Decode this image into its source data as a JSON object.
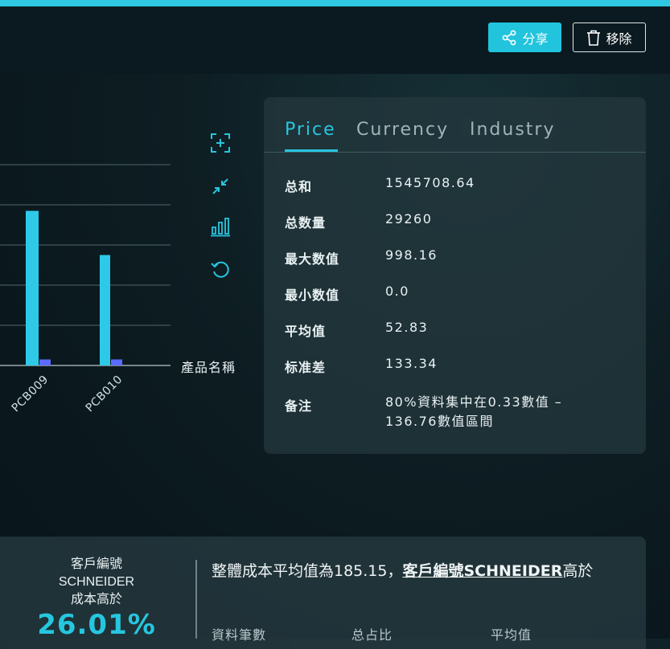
{
  "header": {
    "share_label": "分享",
    "remove_label": "移除",
    "share_icon": "share-icon",
    "remove_icon": "trash-icon"
  },
  "toolbar": {
    "icons": [
      "focus-plus-icon",
      "collapse-icon",
      "bar-chart-icon",
      "reset-icon"
    ]
  },
  "chart_data": {
    "type": "bar",
    "x_label": "產品名稱",
    "categories": [
      "PCB009",
      "PCB010"
    ],
    "series": [
      {
        "color": "#2fc9e8",
        "values": [
          0.77,
          0.55
        ]
      },
      {
        "color": "#5a6cff",
        "values": [
          0.03,
          0.03
        ]
      }
    ],
    "ylim": [
      0,
      1
    ],
    "grid": true
  },
  "stats_panel": {
    "tabs": [
      {
        "label": "Price",
        "active": true
      },
      {
        "label": "Currency",
        "active": false
      },
      {
        "label": "Industry",
        "active": false
      }
    ],
    "rows": [
      {
        "label": "总和",
        "value": "1545708.64"
      },
      {
        "label": "总数量",
        "value": "29260"
      },
      {
        "label": "最大数值",
        "value": "998.16"
      },
      {
        "label": "最小数值",
        "value": "0.0"
      },
      {
        "label": "平均值",
        "value": "52.83"
      },
      {
        "label": "标准差",
        "value": "133.34"
      },
      {
        "label": "备注",
        "value": "80%資料集中在0.33數值 – 136.76數值區間"
      }
    ]
  },
  "bottom": {
    "customer_line1": "客戶編號",
    "customer_line2": "SCHNEIDER",
    "customer_line3": "成本高於",
    "percent": "26.01%",
    "summary_prefix": "整體成本平均值為185.15，",
    "summary_link": "客戶編號SCHNEIDER",
    "summary_suffix": "高於",
    "columns": [
      "資料筆數",
      "总占比",
      "平均值"
    ]
  },
  "colors": {
    "accent": "#27c6df",
    "bar_primary": "#2fc9e8",
    "bar_secondary": "#5a6cff"
  }
}
